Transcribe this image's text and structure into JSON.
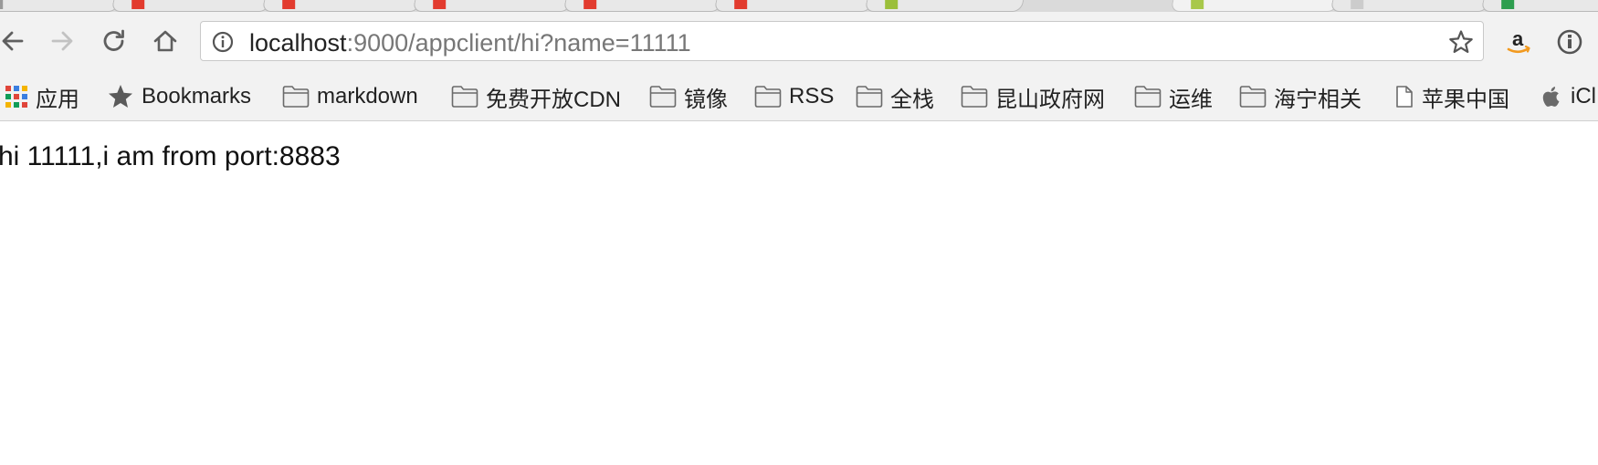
{
  "browser": {
    "tabs": [
      {
        "favicon_color": "#999999",
        "active": false
      },
      {
        "favicon_color": "#e23b2e",
        "active": false
      },
      {
        "favicon_color": "#e23b2e",
        "active": false
      },
      {
        "favicon_color": "#e23b2e",
        "active": false
      },
      {
        "favicon_color": "#e23b2e",
        "active": false
      },
      {
        "favicon_color": "#e23b2e",
        "active": false
      },
      {
        "favicon_color": "#9bbf3a",
        "active": false
      },
      {
        "favicon_color": "#a8c84a",
        "active": true
      },
      {
        "favicon_color": "#cccccc",
        "active": false
      },
      {
        "favicon_color": "#2e9e4f",
        "active": false
      }
    ],
    "toolbar": {
      "back_icon": "arrow-left-icon",
      "forward_icon": "arrow-right-icon",
      "reload_icon": "reload-icon",
      "home_icon": "home-icon",
      "extension_amazon_icon": "amazon-icon",
      "extension_info_icon": "info-icon"
    },
    "address_bar": {
      "host": "localhost",
      "rest": ":9000/appclient/hi?name=11111",
      "info_icon": "info-circle-icon",
      "star_icon": "star-outline-icon"
    },
    "bookmarks": [
      {
        "label": "应用",
        "icon": "apps-grid-icon"
      },
      {
        "label": "Bookmarks",
        "icon": "star-icon"
      },
      {
        "label": "markdown",
        "icon": "folder-icon"
      },
      {
        "label": "免费开放CDN",
        "icon": "folder-icon"
      },
      {
        "label": "镜像",
        "icon": "folder-icon"
      },
      {
        "label": "RSS",
        "icon": "folder-icon"
      },
      {
        "label": "全栈",
        "icon": "folder-icon"
      },
      {
        "label": "昆山政府网",
        "icon": "folder-icon"
      },
      {
        "label": "运维",
        "icon": "folder-icon"
      },
      {
        "label": "海宁相关",
        "icon": "folder-icon"
      },
      {
        "label": "苹果中国",
        "icon": "page-icon"
      },
      {
        "label": "iCl",
        "icon": "apple-icon"
      }
    ]
  },
  "page": {
    "message": "hi 11111,i am from port:8883"
  }
}
